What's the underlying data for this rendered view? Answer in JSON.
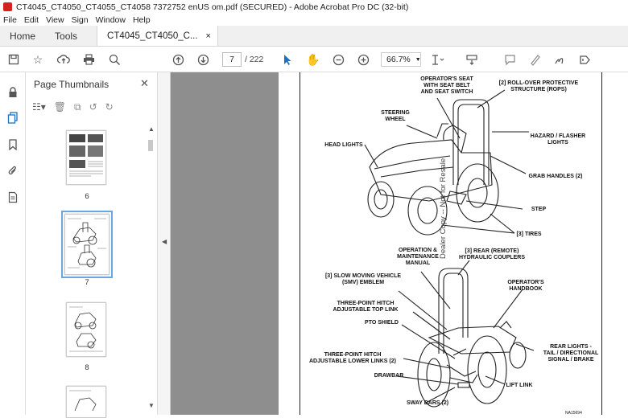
{
  "window": {
    "title": "CT4045_CT4050_CT4055_CT4058 7372752 enUS om.pdf (SECURED) - Adobe Acrobat Pro DC (32-bit)"
  },
  "menu": [
    "File",
    "Edit",
    "View",
    "Sign",
    "Window",
    "Help"
  ],
  "tabs": {
    "home": "Home",
    "tools": "Tools",
    "document": "CT4045_CT4050_C...",
    "close_glyph": "×"
  },
  "toolbar": {
    "page_current": "7",
    "page_total": "/  222",
    "zoom": "66.7%",
    "icons": [
      "save-icon",
      "bookmark-star-icon",
      "upload-icon",
      "print-icon",
      "search-zoom-icon",
      "page-up-icon",
      "page-down-icon",
      "select-cursor-icon",
      "hand-icon",
      "zoom-out-icon",
      "zoom-in-icon",
      "fit-page-icon",
      "scroll-mode-icon",
      "comment-icon",
      "highlight-icon",
      "sign-icon",
      "share-icon"
    ]
  },
  "panel": {
    "title": "Page Thumbnails",
    "close_glyph": "✕",
    "thumbnails": [
      {
        "number": "6"
      },
      {
        "number": "7",
        "selected": true
      },
      {
        "number": "8"
      },
      {
        "number": ""
      }
    ]
  },
  "document": {
    "labels": {
      "operators_seat": "OPERATOR'S SEAT\nWITH SEAT BELT\nAND SEAT SWITCH",
      "rops": "[2] ROLL-OVER PROTECTIVE\nSTRUCTURE (ROPS)",
      "steering_wheel": "STEERING\nWHEEL",
      "hazard_lights": "HAZARD / FLASHER\nLIGHTS",
      "head_lights": "HEAD LIGHTS",
      "grab_handles": "GRAB HANDLES (2)",
      "step": "STEP",
      "tires": "[3] TIRES",
      "manual": "OPERATION &\nMAINTENANCE\nMANUAL",
      "couplers": "[3] REAR (REMOTE)\nHYDRAULIC COUPLERS",
      "smv": "[3] SLOW MOVING VEHICLE\n(SMV) EMBLEM",
      "handbook": "OPERATOR'S\nHANDBOOK",
      "top_link": "THREE-POINT HITCH\nADJUSTABLE TOP LINK",
      "pto_shield": "PTO SHIELD",
      "rear_lights": "REAR LIGHTS -\nTAIL / DIRECTIONAL\nSIGNAL / BRAKE",
      "lower_links": "THREE-POINT HITCH\nADJUSTABLE LOWER LINKS (2)",
      "drawbar": "DRAWBAR",
      "lift_link": "LIFT LINK",
      "sway_bars": "SWAY BARS (2)",
      "figure_code": "NA15694"
    },
    "watermark": "Dealer Copy -- Not for Resale"
  }
}
